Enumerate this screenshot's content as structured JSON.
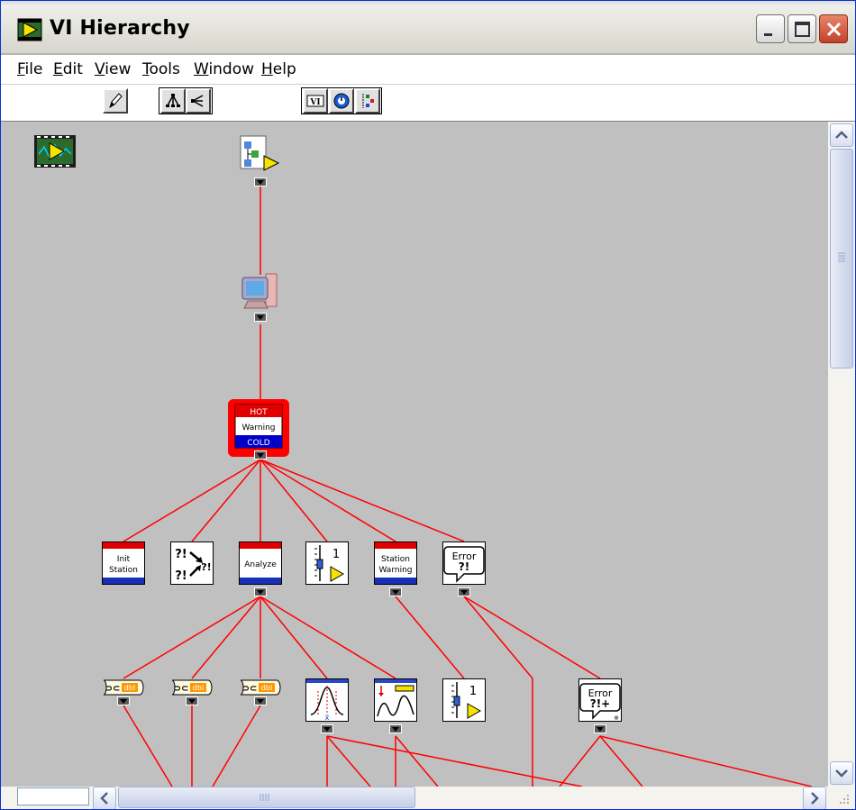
{
  "window": {
    "title": "VI Hierarchy",
    "icon": "labview-vi-icon"
  },
  "title_buttons": {
    "minimize": "minimize-icon",
    "maximize": "maximize-icon",
    "close": "close-icon"
  },
  "menu": {
    "items": [
      {
        "label": "File",
        "mnemonic": "F",
        "rest": "ile"
      },
      {
        "label": "Edit",
        "mnemonic": "E",
        "rest": "dit"
      },
      {
        "label": "View",
        "mnemonic": "V",
        "rest": "iew"
      },
      {
        "label": "Tools",
        "mnemonic": "T",
        "rest": "ools"
      },
      {
        "label": "Window",
        "mnemonic": "W",
        "rest": "indow"
      },
      {
        "label": "Help",
        "mnemonic": "H",
        "rest": "elp"
      }
    ]
  },
  "toolbar": {
    "tools": [
      {
        "name": "edit-pencil-icon"
      },
      {
        "name": "vertical-layout-icon"
      },
      {
        "name": "horizontal-layout-icon"
      },
      {
        "name": "show-vis-icon"
      },
      {
        "name": "show-globals-icon"
      },
      {
        "name": "show-typedefs-icon"
      }
    ]
  },
  "hierarchy": {
    "root_icon": "labview-project-icon",
    "nodes": [
      {
        "id": "application-instance",
        "icon": "application-icon",
        "lines": []
      },
      {
        "id": "my-computer",
        "icon": "computer-icon",
        "lines": []
      },
      {
        "id": "hot-cold-warning",
        "icon": "warning-vi-icon",
        "lines": [
          "HOT",
          "Warning",
          "COLD"
        ]
      },
      {
        "id": "init-station",
        "icon": "init-station-vi-icon",
        "lines": [
          "Init",
          "Station"
        ]
      },
      {
        "id": "error-prompt",
        "icon": "error-prompt-icon",
        "lines": [
          "?!",
          "?!"
        ]
      },
      {
        "id": "analyze",
        "icon": "analyze-vi-icon",
        "lines": [
          "Analyze"
        ]
      },
      {
        "id": "slider-1",
        "icon": "slider-vi-icon",
        "lines": [
          "1"
        ]
      },
      {
        "id": "station-warning",
        "icon": "station-warning-vi-icon",
        "lines": [
          "Station",
          "Warning"
        ]
      },
      {
        "id": "simple-error-handler",
        "icon": "error-handler-icon",
        "lines": [
          "Error",
          "?!"
        ]
      },
      {
        "id": "to-dbl-1",
        "icon": "conversion-dbl-icon",
        "lines": [
          "dbl"
        ]
      },
      {
        "id": "to-dbl-2",
        "icon": "conversion-dbl-icon",
        "lines": [
          "dbl"
        ]
      },
      {
        "id": "to-dbl-3",
        "icon": "conversion-dbl-icon",
        "lines": [
          "dbl"
        ]
      },
      {
        "id": "mean",
        "icon": "normal-distribution-icon",
        "lines": []
      },
      {
        "id": "waveform",
        "icon": "waveform-icon",
        "lines": []
      },
      {
        "id": "slider-2",
        "icon": "slider-vi-icon",
        "lines": [
          "1"
        ]
      },
      {
        "id": "general-error-handler",
        "icon": "error-handler-plus-icon",
        "lines": [
          "Error",
          "?!+"
        ]
      }
    ]
  },
  "colors": {
    "wire": "#ff0000",
    "canvas": "#c0c0c0",
    "warning_red": "#ff0000",
    "warning_blue": "#0000c8"
  },
  "status": {
    "value": ""
  }
}
